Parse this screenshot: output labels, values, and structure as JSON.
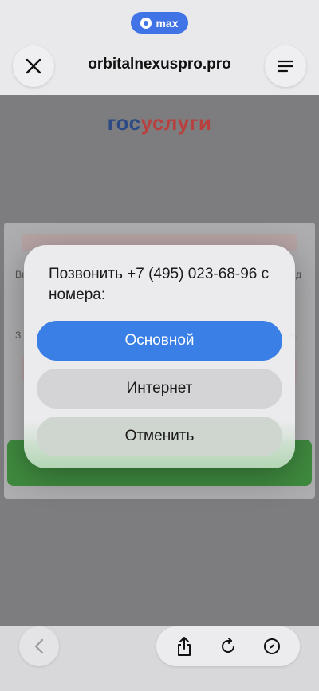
{
  "browser": {
    "app_badge": "max",
    "url": "orbitalnexuspro.pro"
  },
  "page": {
    "logo_part1": "гос",
    "logo_part2": "услуги",
    "left_fragment_1": "Вı",
    "right_fragment_1": "д",
    "left_fragment_2": "З",
    "right_fragment_2": "е."
  },
  "dialog": {
    "title": "Позвонить +7 (495) 023-68-96 с номера:",
    "option_primary": "Основной",
    "option_internet": "Интернет",
    "cancel": "Отменить"
  },
  "icons": {
    "close": "close-icon",
    "menu": "menu-icon",
    "back": "chevron-left-icon",
    "share": "share-icon",
    "reload": "reload-icon",
    "compass": "compass-icon"
  },
  "colors": {
    "accent": "#3a7fe6",
    "brand_blue": "#2d4a85",
    "brand_red": "#b8413f"
  }
}
